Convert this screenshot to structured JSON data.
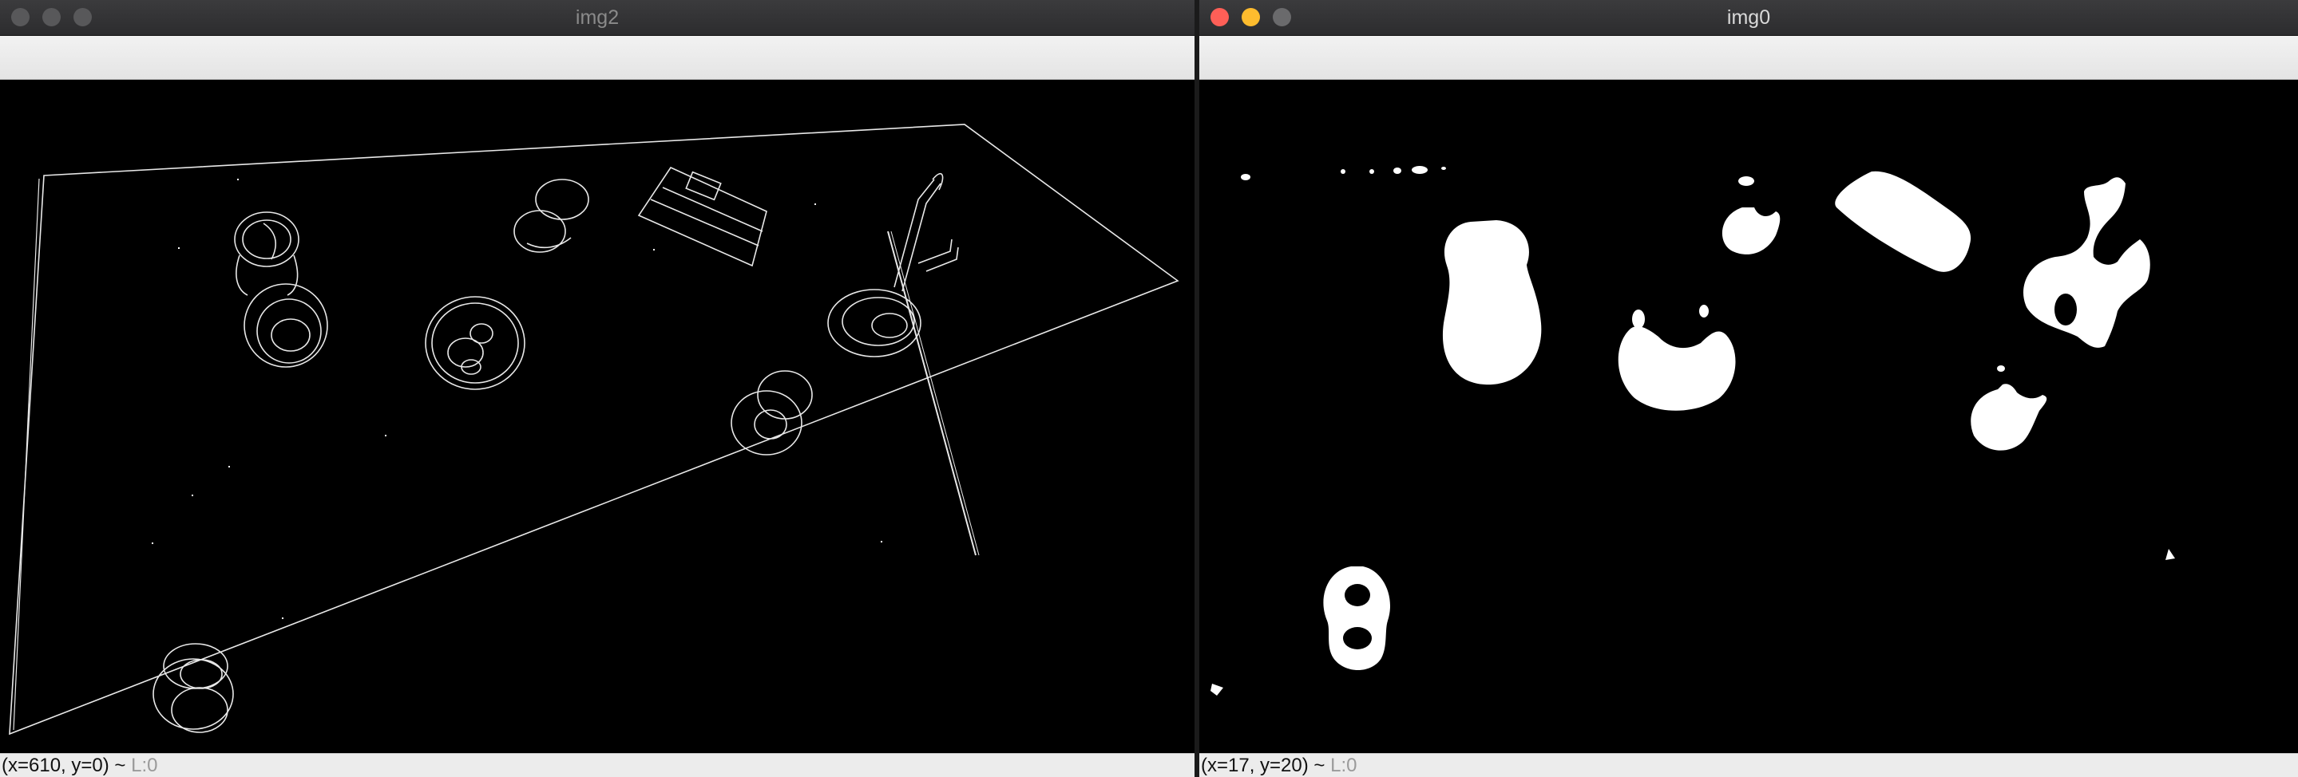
{
  "windows": [
    {
      "title": "img2",
      "status": {
        "coords": "(x=610, y=0) ~",
        "label": "L:0"
      },
      "image_kind": "canny-edge-map"
    },
    {
      "title": "img0",
      "status": {
        "coords": "(x=17, y=20) ~",
        "label": "L:0"
      },
      "image_kind": "binary-threshold-mask"
    }
  ],
  "colors": {
    "edge_stroke": "#ffffff",
    "mask_fill": "#ffffff",
    "canvas_bg": "#000000",
    "close_button": "#fe5f57",
    "minimize_button": "#febc2e"
  }
}
